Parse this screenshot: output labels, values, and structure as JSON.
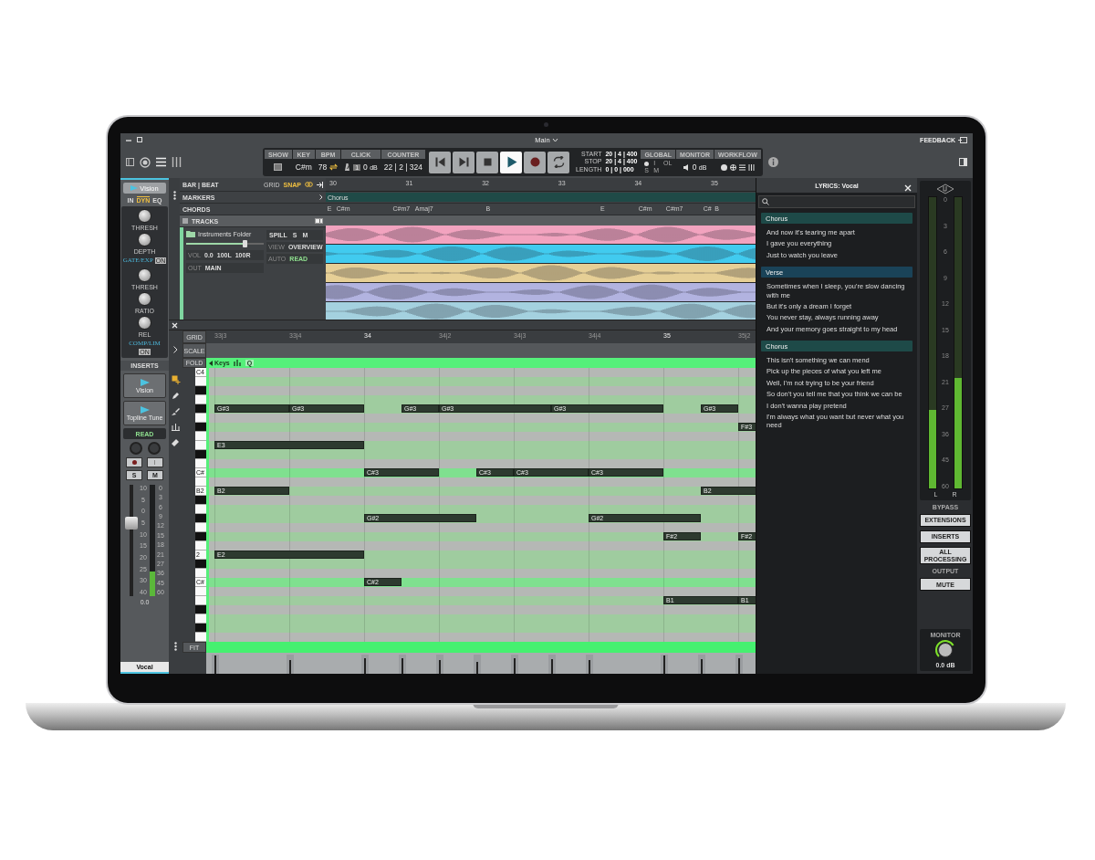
{
  "window": {
    "title": "Main",
    "feedback": "FEEDBACK"
  },
  "transport": {
    "show": {
      "label": "SHOW"
    },
    "key": {
      "label": "KEY",
      "value": "C#m"
    },
    "bpm": {
      "label": "BPM",
      "value": "78"
    },
    "click": {
      "label": "CLICK",
      "beat": "1",
      "value": "0",
      "unit": "dB"
    },
    "counter": {
      "label": "COUNTER",
      "value": "22 | 2 | 324"
    },
    "buttons": [
      {
        "kind": "back",
        "selected": false
      },
      {
        "kind": "forward",
        "selected": false
      },
      {
        "kind": "stop",
        "selected": false
      },
      {
        "kind": "play",
        "selected": true
      },
      {
        "kind": "record",
        "selected": false
      },
      {
        "kind": "loop",
        "selected": false
      }
    ],
    "range": [
      {
        "label": "START",
        "value": "20 | 4 | 400"
      },
      {
        "label": "STOP",
        "value": "20 | 4 | 400"
      },
      {
        "label": "LENGTH",
        "value": "0 | 0 | 000"
      }
    ],
    "global": {
      "label": "GLOBAL",
      "items": [
        "I",
        "OL",
        "S",
        "M"
      ]
    },
    "monitor": {
      "label": "MONITOR",
      "value": "0",
      "unit": "dB"
    },
    "workflow": {
      "label": "WORKFLOW"
    }
  },
  "channel_strip": {
    "plugin": "Vision",
    "tabs": [
      {
        "label": "IN",
        "selected": false
      },
      {
        "label": "DYN",
        "selected": true
      },
      {
        "label": "EQ",
        "selected": false
      }
    ],
    "dynamics": [
      {
        "title": "GATE/EXP",
        "switch": "ON",
        "knobs": [
          "THRESH",
          "DEPTH"
        ]
      },
      {
        "title": "COMP/LIM",
        "switch": "ON",
        "knobs": [
          "THRESH",
          "RATIO",
          "REL"
        ]
      }
    ],
    "inserts_label": "INSERTS",
    "inserts": [
      "Vision",
      "Topline Tune"
    ],
    "automation": "READ",
    "solo": "S",
    "mute": "M",
    "fader": {
      "level": 0.68
    },
    "fader_scale": [
      "10",
      "5",
      "0",
      "5",
      "10",
      "15",
      "20",
      "25",
      "30",
      "40"
    ],
    "meter": {
      "level": 0.22
    },
    "meter_scale": [
      "0",
      "3",
      "6",
      "9",
      "12",
      "15",
      "18",
      "21",
      "27",
      "36",
      "45",
      "60"
    ],
    "volume": "0.0",
    "name": "Vocal"
  },
  "arranger": {
    "bar_beat": "BAR | BEAT",
    "grid": "GRID",
    "snap": "SNAP",
    "markers_label": "MARKERS",
    "chords_label": "CHORDS",
    "tracks_label": "TRACKS",
    "folder": {
      "name": "Instruments Folder",
      "spill": "SPILL",
      "solo": "S",
      "mute": "M",
      "level": 0.75,
      "view_label": "VIEW",
      "view": "OVERVIEW",
      "vol_label": "VOL",
      "vol": "0.0",
      "pan_left": "100L",
      "pan_right": "100R",
      "auto_label": "AUTO",
      "auto": "READ",
      "out_label": "OUT",
      "out": "MAIN"
    },
    "bars": [
      "30",
      "31",
      "32",
      "33",
      "34",
      "35"
    ],
    "marker": "Chorus",
    "chords": [
      "E",
      "C#m",
      "C#m7",
      "Amaj7",
      "B",
      "E",
      "C#m",
      "C#m7",
      "C#",
      "B"
    ],
    "lanes": [
      {
        "color": "#f2a3bf"
      },
      {
        "color": "#41cbef"
      },
      {
        "color": "#e6cf96"
      },
      {
        "color": "#b2b3e0"
      },
      {
        "color": "#a4d1df"
      }
    ]
  },
  "piano_roll": {
    "grid": "GRID",
    "scale": "SCALE",
    "fold": "FOLD",
    "keys": "Keys",
    "quantize": "Q",
    "fit": "FIT",
    "ruler": [
      "33|3",
      "33|4",
      "34",
      "34|2",
      "34|3",
      "34|4",
      "35",
      "35|2"
    ],
    "rows": [
      {
        "kind": "other",
        "label": "C4"
      },
      {
        "kind": "scale"
      },
      {
        "kind": "other"
      },
      {
        "kind": "scale"
      },
      {
        "kind": "scale"
      },
      {
        "kind": "other"
      },
      {
        "kind": "scale"
      },
      {
        "kind": "other"
      },
      {
        "kind": "scale"
      },
      {
        "kind": "scale"
      },
      {
        "kind": "other"
      },
      {
        "kind": "root",
        "label": "C#"
      },
      {
        "kind": "other"
      },
      {
        "kind": "scale",
        "label": "B2"
      },
      {
        "kind": "other"
      },
      {
        "kind": "scale"
      },
      {
        "kind": "scale"
      },
      {
        "kind": "other"
      },
      {
        "kind": "scale"
      },
      {
        "kind": "other"
      },
      {
        "kind": "scale",
        "label": "2"
      },
      {
        "kind": "scale"
      },
      {
        "kind": "other"
      },
      {
        "kind": "root",
        "label": "C#"
      },
      {
        "kind": "other"
      },
      {
        "kind": "scale"
      },
      {
        "kind": "other"
      },
      {
        "kind": "scale"
      },
      {
        "kind": "scale"
      },
      {
        "kind": "other"
      }
    ],
    "notes": [
      {
        "label": "G#3"
      },
      {
        "label": "G#3"
      },
      {
        "label": "G#3"
      },
      {
        "label": "G#3"
      },
      {
        "label": "G#3"
      },
      {
        "label": "G#3"
      },
      {
        "label": "F#3"
      },
      {
        "label": "E3"
      },
      {
        "label": "C#3"
      },
      {
        "label": "C#3"
      },
      {
        "label": "C#3"
      },
      {
        "label": "C#3"
      },
      {
        "label": "B2"
      },
      {
        "label": "B2"
      },
      {
        "label": "G#2"
      },
      {
        "label": "G#2"
      },
      {
        "label": "F#2"
      },
      {
        "label": "F#2"
      },
      {
        "label": "E2"
      },
      {
        "label": "C#2"
      },
      {
        "label": "B1"
      },
      {
        "label": "B1"
      }
    ],
    "velocities": [
      {
        "level": 0.95
      },
      {
        "level": 0.7
      },
      {
        "level": 0.8
      },
      {
        "level": 0.8
      },
      {
        "level": 0.7
      },
      {
        "level": 0.6
      },
      {
        "level": 0.8
      },
      {
        "level": 0.75
      },
      {
        "level": 0.7
      },
      {
        "level": 0.95
      },
      {
        "level": 0.75
      },
      {
        "level": 0.8
      }
    ]
  },
  "lyrics": {
    "title": "LYRICS: Vocal",
    "sections": [
      {
        "title": "Chorus",
        "color": "#1e4a48",
        "lines": [
          "And now it's tearing me apart",
          "I gave you everything",
          "Just to watch you leave"
        ]
      },
      {
        "title": "Verse",
        "color": "#1a4358",
        "lines": [
          "Sometimes when I sleep, you're slow dancing with me",
          "But it's only a dream I forget",
          "You never stay, always running away",
          "And your memory goes straight to my head"
        ]
      },
      {
        "title": "Chorus",
        "color": "#1e4a48",
        "lines": [
          "This isn't something we can mend",
          "Pick up the pieces of what you left me",
          "Well, I'm not trying to be your friend",
          "So don't you tell me that you think we can be",
          "I don't wanna play pretend",
          "I'm always what you want but never what you need"
        ]
      }
    ]
  },
  "output": {
    "scale": [
      "0",
      "3",
      "6",
      "9",
      "12",
      "15",
      "18",
      "21",
      "27",
      "36",
      "45",
      "60"
    ],
    "meters": [
      {
        "label": "L",
        "level": 0.27
      },
      {
        "label": "R",
        "level": 0.38
      }
    ],
    "bypass_label": "BYPASS",
    "bypass": [
      "EXTENSIONS",
      "INSERTS",
      "ALL PROCESSING"
    ],
    "output_label": "OUTPUT",
    "mute": "MUTE",
    "monitor_label": "MONITOR",
    "monitor": {
      "level": 0.72,
      "value": "0.0 dB"
    }
  }
}
